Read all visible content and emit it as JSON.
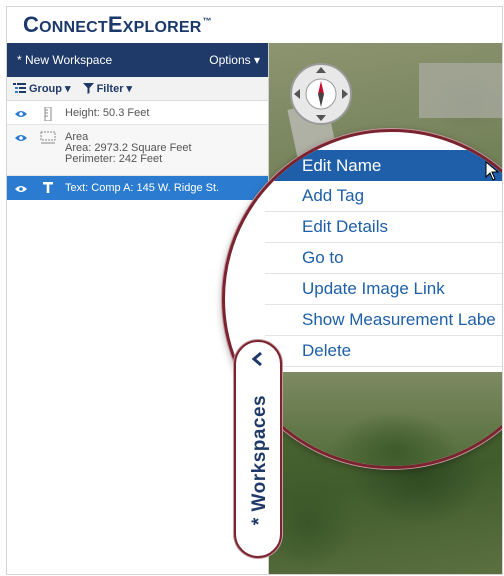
{
  "brand": {
    "c": "C",
    "onnect": "ONNECT",
    "e": "E",
    "xplorer": "XPLORER",
    "tm": "™"
  },
  "workspace_panel": {
    "title": "* New Workspace",
    "options_label": "Options ▾",
    "toolbar": {
      "group_label": "Group ▾",
      "filter_label": "Filter ▾"
    },
    "items": [
      {
        "icon": "ruler-vertical-icon",
        "lines": [
          "Height: 50.3 Feet"
        ],
        "selected": false
      },
      {
        "icon": "area-measure-icon",
        "lines": [
          "Area",
          "Area: 2973.2 Square Feet",
          "Perimeter: 242 Feet"
        ],
        "selected": false
      },
      {
        "icon": "text-T-icon",
        "lines": [
          "Text: Comp A: 145 W. Ridge St."
        ],
        "selected": true
      }
    ]
  },
  "context_menu": {
    "items": [
      "Edit Name",
      "Add Tag",
      "Edit Details",
      "Go to",
      "Update Image Link",
      "Show Measurement Labe",
      "Delete"
    ],
    "active_index": 0
  },
  "workspaces_tab": {
    "label": "* Workspaces"
  },
  "colors": {
    "navy": "#1f3a68",
    "selected_blue": "#2b7cd0",
    "menu_blue": "#1e5fa8",
    "magnifier_border": "#7a2430"
  }
}
